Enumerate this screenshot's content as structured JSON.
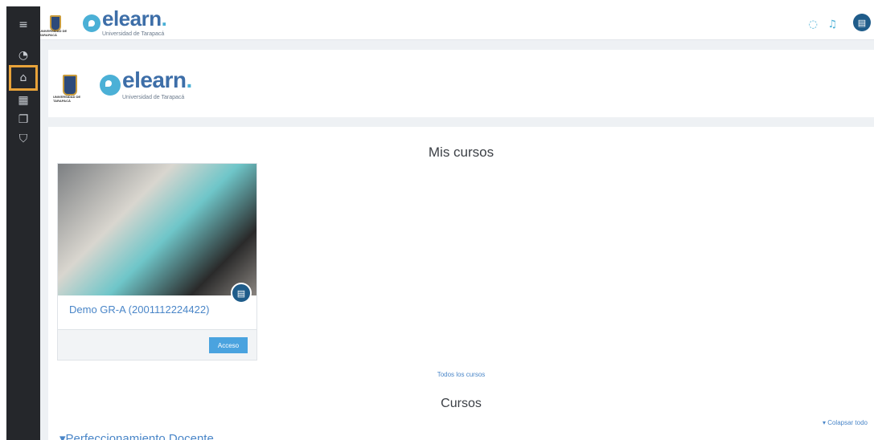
{
  "sidebar": {
    "items": [
      {
        "name": "menu-toggle",
        "icon": "hamburger-icon",
        "glyph": "≡"
      },
      {
        "name": "dashboard",
        "icon": "dashboard-icon",
        "glyph": "◔"
      },
      {
        "name": "home",
        "icon": "home-icon",
        "glyph": "⌂"
      },
      {
        "name": "calendar",
        "icon": "calendar-icon",
        "glyph": "▦"
      },
      {
        "name": "files",
        "icon": "files-icon",
        "glyph": "❐"
      },
      {
        "name": "courses",
        "icon": "graduation-icon",
        "glyph": "⛉"
      }
    ],
    "active": "home"
  },
  "header": {
    "brand": "elearn",
    "brand_dot": ".",
    "university": "Universidad de Tarapacá",
    "crest_text": "UNIVERSIDAD DE TARAPACÁ",
    "icons": {
      "messages": "◌",
      "notifications": "♫"
    }
  },
  "main": {
    "my_courses_title": "Mis cursos",
    "course_card": {
      "title": "Demo GR-A (2001112224422)",
      "button": "Acceso"
    },
    "all_courses_link": "Todos los cursos",
    "courses_title": "Cursos",
    "collapse_all": "▾ Colapsar todo",
    "category": "▾Perfeccionamiento Docente"
  },
  "colors": {
    "accent": "#4aa3df",
    "sidebar": "#25272b",
    "highlight": "#e8a33a"
  }
}
